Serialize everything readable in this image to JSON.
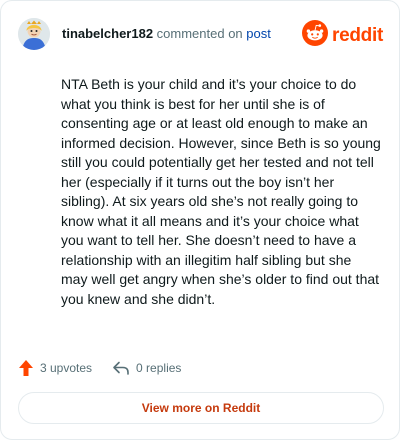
{
  "comment": {
    "username": "tinabelcher182",
    "commented_on": "commented on",
    "post_link": "post",
    "body": "NTA Beth is your child and it’s your choice to do what you think is best for her until she is of consenting age or at least old enough to make an informed decision. However, since Beth is so young still you could potentially get her tested and not tell her (especially if it turns out the boy isn’t her sibling). At six years old she’s not really going to know what it all means and it’s your choice what you want to tell her. She doesn’t need to have a relationship with an illegitim half sibling but she may well get angry when she’s older to find out that you knew and she didn’t."
  },
  "brand": {
    "wordmark": "reddit",
    "icon": "reddit-snoo-icon",
    "color": "#ff4500"
  },
  "actions": {
    "upvotes_label": "3 upvotes",
    "upvote_icon": "upvote-arrow-icon",
    "upvote_color": "#ff4500",
    "replies_label": "0 replies",
    "reply_icon": "reply-arrow-icon"
  },
  "view_more_label": "View more on Reddit",
  "colors": {
    "accent_text": "#c53a0d",
    "link": "#0045ac",
    "muted": "#576f76"
  }
}
